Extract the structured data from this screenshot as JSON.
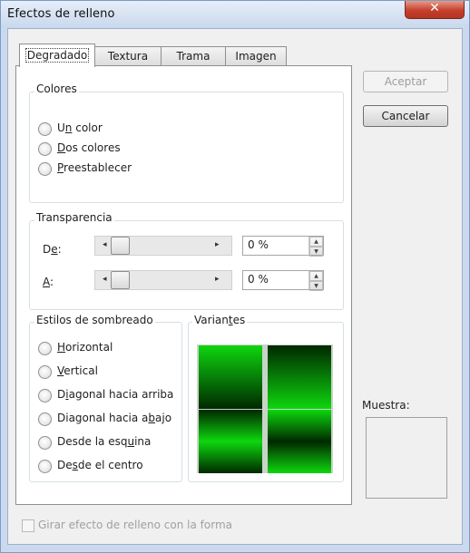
{
  "window": {
    "title": "Efectos de relleno",
    "close_glyph": "✕"
  },
  "tabs": [
    {
      "label": "Degradado",
      "active": true
    },
    {
      "label": "Textura",
      "active": false
    },
    {
      "label": "Trama",
      "active": false
    },
    {
      "label": "Imagen",
      "active": false
    }
  ],
  "colores": {
    "label": "Colores",
    "options": [
      {
        "pre": "U",
        "key": "n",
        "post": " color",
        "checked": false
      },
      {
        "pre": "",
        "key": "D",
        "post": "os colores",
        "checked": false
      },
      {
        "pre": "",
        "key": "P",
        "post": "reestablecer",
        "checked": false
      }
    ]
  },
  "transparencia": {
    "label": "Transparencia",
    "de": {
      "pre": "D",
      "key": "e",
      "post": ":",
      "value": "0 %",
      "level": 0
    },
    "a": {
      "pre": "",
      "key": "A",
      "post": ":",
      "value": "0 %",
      "level": 0
    }
  },
  "estilos": {
    "label": "Estilos de sombreado",
    "options": [
      {
        "pre": "",
        "key": "H",
        "post": "orizontal",
        "checked": false
      },
      {
        "pre": "",
        "key": "V",
        "post": "ertical",
        "checked": false
      },
      {
        "pre": "D",
        "key": "i",
        "post": "agonal hacia arriba",
        "checked": false
      },
      {
        "pre": "Diagonal hacia a",
        "key": "b",
        "post": "ajo",
        "checked": false
      },
      {
        "pre": "Desde la esq",
        "key": "u",
        "post": "ina",
        "checked": false
      },
      {
        "pre": "De",
        "key": "s",
        "post": "de el centro",
        "checked": false
      }
    ]
  },
  "variantes": {
    "pre": "Varian",
    "key": "t",
    "post": "es",
    "colors": {
      "dark": "#002800",
      "bright": "#0ed60e"
    }
  },
  "buttons": {
    "accept": "Aceptar",
    "cancel": "Cancelar"
  },
  "muestra": {
    "label": "Muestra:"
  },
  "rotate_checkbox": {
    "label": "Girar efecto de relleno con la forma",
    "checked": false
  },
  "icons": {
    "slider_left": "◂",
    "slider_right": "▸",
    "spin_up": "▲",
    "spin_down": "▼"
  }
}
